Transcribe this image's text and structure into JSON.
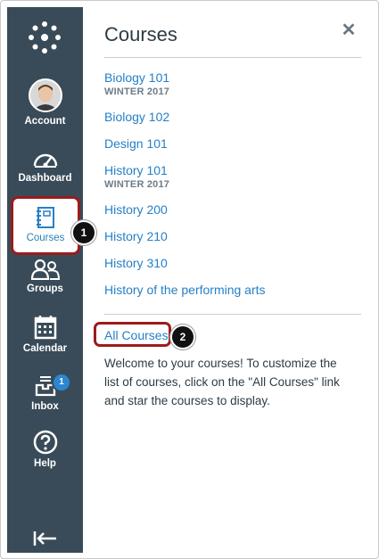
{
  "nav": {
    "account_label": "Account",
    "dashboard_label": "Dashboard",
    "courses_label": "Courses",
    "groups_label": "Groups",
    "calendar_label": "Calendar",
    "inbox_label": "Inbox",
    "inbox_badge": "1",
    "help_label": "Help"
  },
  "tray": {
    "title": "Courses",
    "close_glyph": "✕",
    "courses": [
      {
        "name": "Biology 101",
        "term": "WINTER 2017"
      },
      {
        "name": "Biology 102",
        "term": ""
      },
      {
        "name": "Design 101",
        "term": ""
      },
      {
        "name": "History 101",
        "term": "WINTER 2017"
      },
      {
        "name": "History 200",
        "term": ""
      },
      {
        "name": "History 210",
        "term": ""
      },
      {
        "name": "History 310",
        "term": ""
      },
      {
        "name": "History of the performing arts",
        "term": ""
      }
    ],
    "all_courses_label": "All Courses",
    "welcome_text": "Welcome to your courses! To customize the list of courses, click on the \"All Courses\" link and star the courses to display."
  },
  "callouts": [
    "1",
    "2"
  ],
  "colors": {
    "nav_bg": "#394b58",
    "link": "#2580c8",
    "highlight": "#9b1c1c",
    "badge": "#2b87d1"
  }
}
